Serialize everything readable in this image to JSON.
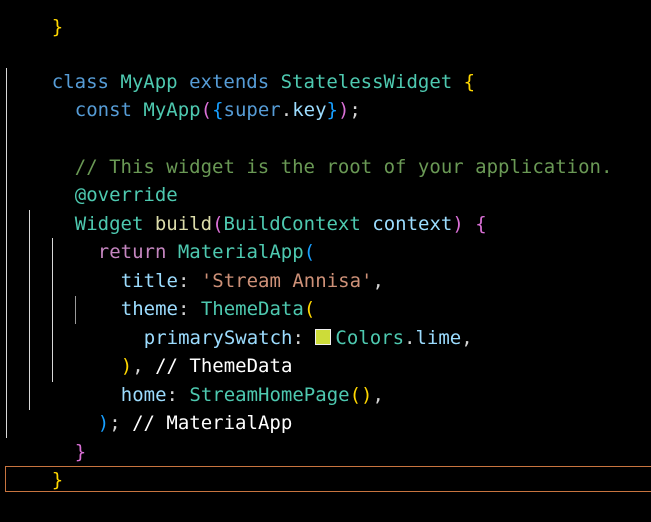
{
  "editor": {
    "lines": [
      {
        "id": "l0",
        "tokens": [
          "}"
        ]
      },
      {
        "id": "l2",
        "tokens": [
          "class",
          " ",
          "MyApp",
          " ",
          "extends",
          " ",
          "StatelessWidget",
          " ",
          "{"
        ]
      },
      {
        "id": "l3",
        "tokens": [
          "const",
          " ",
          "MyApp",
          "(",
          "{",
          "super",
          ".",
          "key",
          "}",
          ")",
          ";"
        ]
      },
      {
        "id": "l5",
        "tokens": [
          "// This widget is the root of your application."
        ]
      },
      {
        "id": "l6",
        "tokens": [
          "@override"
        ]
      },
      {
        "id": "l7",
        "tokens": [
          "Widget",
          " ",
          "build",
          "(",
          "BuildContext",
          " ",
          "context",
          ")",
          " ",
          "{"
        ]
      },
      {
        "id": "l8",
        "tokens": [
          "return",
          " ",
          "MaterialApp",
          "("
        ]
      },
      {
        "id": "l9",
        "tokens": [
          "title",
          ": ",
          "'Stream Annisa'",
          ","
        ]
      },
      {
        "id": "l10",
        "tokens": [
          "theme",
          ": ",
          "ThemeData",
          "("
        ]
      },
      {
        "id": "l11",
        "tokens": [
          "primarySwatch",
          ": ",
          "Colors",
          ".",
          "lime",
          ","
        ]
      },
      {
        "id": "l12",
        "tokens": [
          ")",
          ", ",
          "// ThemeData"
        ]
      },
      {
        "id": "l13",
        "tokens": [
          "home",
          ": ",
          "StreamHomePage",
          "(",
          ")",
          ","
        ]
      },
      {
        "id": "l14",
        "tokens": [
          ")",
          "; ",
          "// MaterialApp"
        ]
      },
      {
        "id": "l15",
        "tokens": [
          "}"
        ]
      },
      {
        "id": "l16",
        "tokens": [
          "}"
        ]
      }
    ]
  },
  "colors": {
    "background": "#000000",
    "keyword_blue": "#569cd6",
    "keyword_pink": "#c586c0",
    "class_teal": "#4ec9b0",
    "function_yellow": "#dcdcaa",
    "variable_lightblue": "#9cdcfe",
    "string_orange": "#ce9178",
    "comment_green": "#6a9955",
    "bracket_gold": "#ffd700",
    "bracket_orchid": "#da70d6",
    "bracket_blue": "#179fff",
    "lime_swatch": "#cddc39",
    "current_line_border": "#c8743f"
  }
}
